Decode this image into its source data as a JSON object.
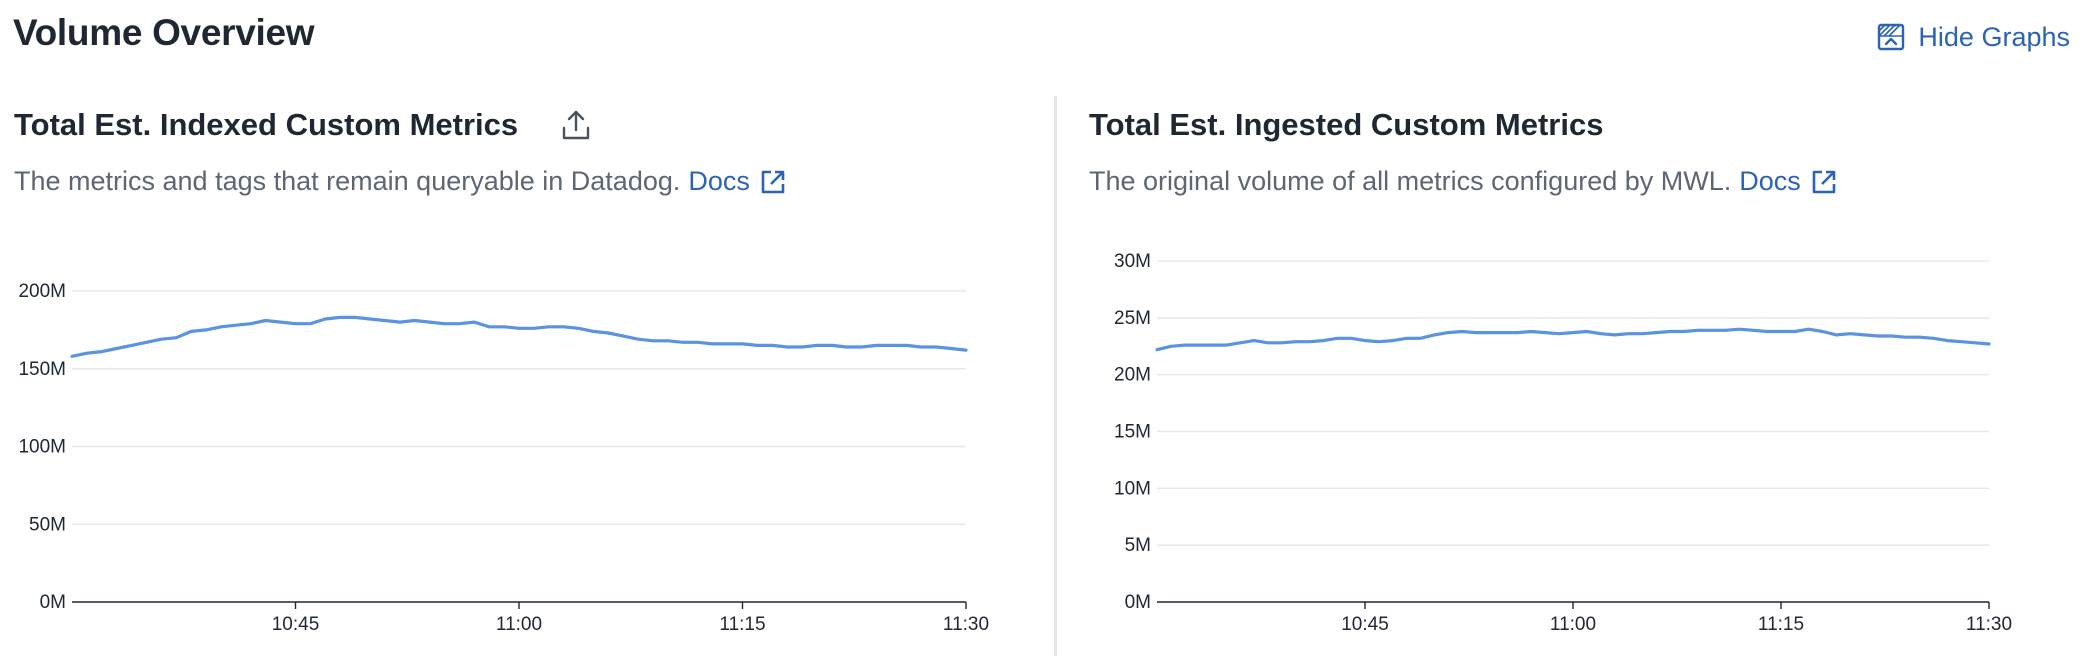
{
  "header": {
    "title": "Volume Overview",
    "hide_graphs_label": "Hide Graphs"
  },
  "colors": {
    "accent": "#2c63b6",
    "series_line": "#5b93e0",
    "grid": "#e6e8eb",
    "text": "#1f2733",
    "muted_text": "#5d6674"
  },
  "icons": {
    "hide_graphs": "collapse-graphs-icon",
    "export": "upload-export-icon",
    "external_link": "external-link-icon"
  },
  "panels": [
    {
      "title": "Total Est. Indexed Custom Metrics",
      "description": "The metrics and tags that remain queryable in Datadog.",
      "docs_label": "Docs"
    },
    {
      "title": "Total Est. Ingested Custom Metrics",
      "description": "The original volume of all metrics configured by MWL.",
      "docs_label": "Docs"
    }
  ],
  "chart_data": [
    {
      "type": "line",
      "title": "Total Est. Indexed Custom Metrics",
      "xlabel": "",
      "ylabel": "",
      "y_ticks": [
        "0M",
        "50M",
        "100M",
        "150M",
        "200M"
      ],
      "ylim": [
        0,
        200
      ],
      "x_tick_labels": [
        "10:45",
        "11:00",
        "11:15",
        "11:30"
      ],
      "x_tick_minutes": [
        45,
        60,
        75,
        90
      ],
      "xlim": [
        30,
        90
      ],
      "grid": true,
      "series": [
        {
          "x": [
            30,
            31,
            32,
            33,
            34,
            35,
            36,
            37,
            38,
            39,
            40,
            41,
            42,
            43,
            44,
            45,
            46,
            47,
            48,
            49,
            50,
            51,
            52,
            53,
            54,
            55,
            56,
            57,
            58,
            59,
            60,
            61,
            62,
            63,
            64,
            65,
            66,
            67,
            68,
            69,
            70,
            71,
            72,
            73,
            74,
            75,
            76,
            77,
            78,
            79,
            80,
            81,
            82,
            83,
            84,
            85,
            86,
            87,
            88,
            89,
            90
          ],
          "y": [
            158,
            160,
            161,
            163,
            165,
            167,
            169,
            170,
            174,
            175,
            177,
            178,
            179,
            181,
            180,
            179,
            179,
            182,
            183,
            183,
            182,
            181,
            180,
            181,
            180,
            179,
            179,
            180,
            177,
            177,
            176,
            176,
            177,
            177,
            176,
            174,
            173,
            171,
            169,
            168,
            168,
            167,
            167,
            166,
            166,
            166,
            165,
            165,
            164,
            164,
            165,
            165,
            164,
            164,
            165,
            165,
            165,
            164,
            164,
            163,
            162
          ]
        }
      ]
    },
    {
      "type": "line",
      "title": "Total Est. Ingested Custom Metrics",
      "xlabel": "",
      "ylabel": "",
      "y_ticks": [
        "0M",
        "5M",
        "10M",
        "15M",
        "20M",
        "25M",
        "30M"
      ],
      "ylim": [
        0,
        30
      ],
      "x_tick_labels": [
        "10:45",
        "11:00",
        "11:15",
        "11:30"
      ],
      "x_tick_minutes": [
        45,
        60,
        75,
        90
      ],
      "xlim": [
        30,
        90
      ],
      "grid": true,
      "series": [
        {
          "x": [
            30,
            31,
            32,
            33,
            34,
            35,
            36,
            37,
            38,
            39,
            40,
            41,
            42,
            43,
            44,
            45,
            46,
            47,
            48,
            49,
            50,
            51,
            52,
            53,
            54,
            55,
            56,
            57,
            58,
            59,
            60,
            61,
            62,
            63,
            64,
            65,
            66,
            67,
            68,
            69,
            70,
            71,
            72,
            73,
            74,
            75,
            76,
            77,
            78,
            79,
            80,
            81,
            82,
            83,
            84,
            85,
            86,
            87,
            88,
            89,
            90
          ],
          "y": [
            22.2,
            22.5,
            22.6,
            22.6,
            22.6,
            22.6,
            22.8,
            23.0,
            22.8,
            22.8,
            22.9,
            22.9,
            23.0,
            23.2,
            23.2,
            23.0,
            22.9,
            23.0,
            23.2,
            23.2,
            23.5,
            23.7,
            23.8,
            23.7,
            23.7,
            23.7,
            23.7,
            23.8,
            23.7,
            23.6,
            23.7,
            23.8,
            23.6,
            23.5,
            23.6,
            23.6,
            23.7,
            23.8,
            23.8,
            23.9,
            23.9,
            23.9,
            24.0,
            23.9,
            23.8,
            23.8,
            23.8,
            24.0,
            23.8,
            23.5,
            23.6,
            23.5,
            23.4,
            23.4,
            23.3,
            23.3,
            23.2,
            23.0,
            22.9,
            22.8,
            22.7
          ]
        }
      ]
    }
  ]
}
